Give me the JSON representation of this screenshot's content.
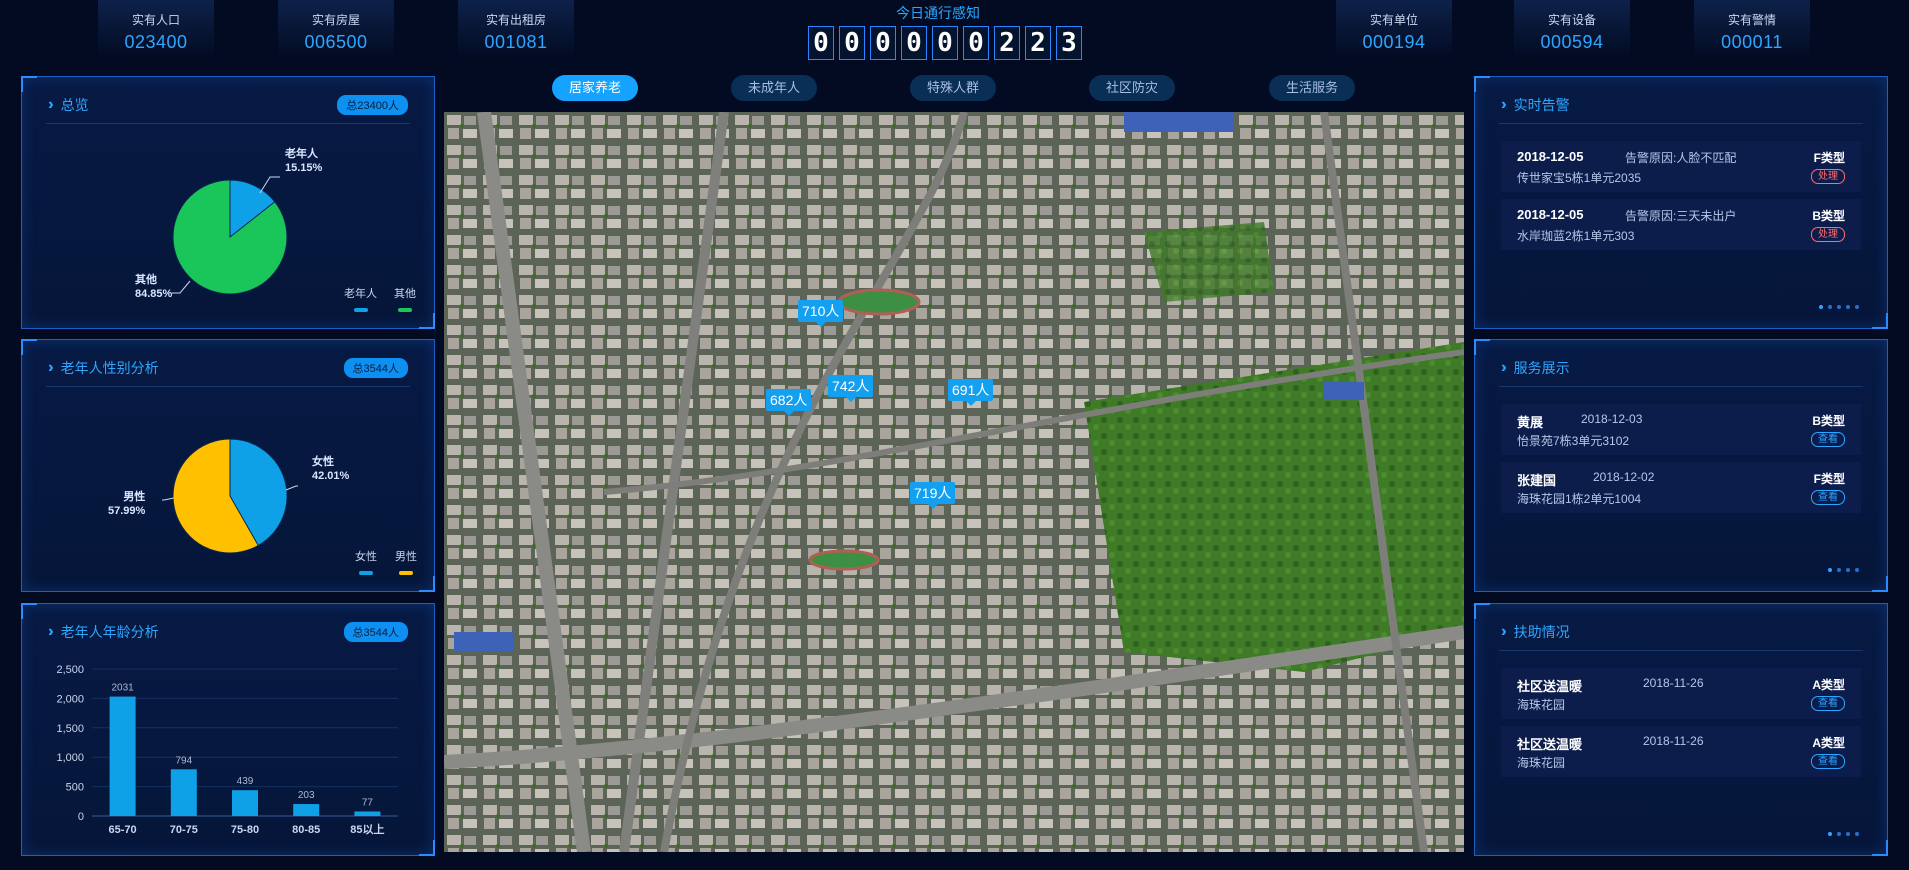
{
  "top_stats_left": [
    {
      "label": "实有人口",
      "value": "023400"
    },
    {
      "label": "实有房屋",
      "value": "006500"
    },
    {
      "label": "实有出租房",
      "value": "001081"
    }
  ],
  "top_stats_right": [
    {
      "label": "实有单位",
      "value": "000194"
    },
    {
      "label": "实有设备",
      "value": "000594"
    },
    {
      "label": "实有警情",
      "value": "000011"
    }
  ],
  "traffic": {
    "title": "今日通行感知",
    "digits": [
      "0",
      "0",
      "0",
      "0",
      "0",
      "0",
      "2",
      "2",
      "3"
    ]
  },
  "tabs": [
    {
      "label": "居家养老",
      "active": true
    },
    {
      "label": "未成年人",
      "active": false
    },
    {
      "label": "特殊人群",
      "active": false
    },
    {
      "label": "社区防灾",
      "active": false
    },
    {
      "label": "生活服务",
      "active": false
    }
  ],
  "overview": {
    "title": "总览",
    "badge": "总23400人",
    "legend": [
      "老年人",
      "其他"
    ],
    "labels": {
      "elderly_name": "老年人",
      "elderly_pct": "15.15%",
      "other_name": "其他",
      "other_pct": "84.85%"
    }
  },
  "gender": {
    "title": "老年人性别分析",
    "badge": "总3544人",
    "legend": [
      "女性",
      "男性"
    ],
    "labels": {
      "female_name": "女性",
      "female_pct": "42.01%",
      "male_name": "男性",
      "male_pct": "57.99%"
    }
  },
  "age": {
    "title": "老年人年龄分析",
    "badge": "总3544人"
  },
  "chart_data": [
    {
      "type": "pie",
      "slices": [
        {
          "name": "老年人",
          "value": 15.15,
          "color": "#0fa1e8"
        },
        {
          "name": "其他",
          "value": 84.85,
          "color": "#1ac659"
        }
      ]
    },
    {
      "type": "pie",
      "slices": [
        {
          "name": "女性",
          "value": 42.01,
          "color": "#0fa1e8"
        },
        {
          "name": "男性",
          "value": 57.99,
          "color": "#ffc000"
        }
      ]
    },
    {
      "type": "bar",
      "categories": [
        "65-70",
        "70-75",
        "75-80",
        "80-85",
        "85以上"
      ],
      "values": [
        2031,
        794,
        439,
        203,
        77
      ],
      "ylim": [
        0,
        2500
      ],
      "yticks": [
        "0",
        "500",
        "1,000",
        "1,500",
        "2,000",
        "2,500"
      ],
      "color": "#0fa1e8",
      "grid": true
    }
  ],
  "alerts": {
    "title": "实时告警",
    "items": [
      {
        "date": "2018-12-05",
        "reason": "告警原因:人脸不匹配",
        "type": "F类型",
        "location": "传世家宝5栋1单元2035",
        "action": "处理"
      },
      {
        "date": "2018-12-05",
        "reason": "告警原因:三天未出户",
        "type": "B类型",
        "location": "水岸珈蓝2栋1单元303",
        "action": "处理"
      }
    ]
  },
  "services": {
    "title": "服务展示",
    "items": [
      {
        "name": "黄展",
        "date": "2018-12-03",
        "type": "B类型",
        "location": "怡景苑7栋3单元3102",
        "action": "查看"
      },
      {
        "name": "张建国",
        "date": "2018-12-02",
        "type": "F类型",
        "location": "海珠花园1栋2单元1004",
        "action": "查看"
      }
    ]
  },
  "assistance": {
    "title": "扶助情况",
    "items": [
      {
        "name": "社区送温暖",
        "date": "2018-11-26",
        "type": "A类型",
        "location": "海珠花园",
        "action": "查看"
      },
      {
        "name": "社区送温暖",
        "date": "2018-11-26",
        "type": "A类型",
        "location": "海珠花园",
        "action": "查看"
      }
    ]
  },
  "map_markers": [
    "710人",
    "742人",
    "682人",
    "691人",
    "719人"
  ]
}
